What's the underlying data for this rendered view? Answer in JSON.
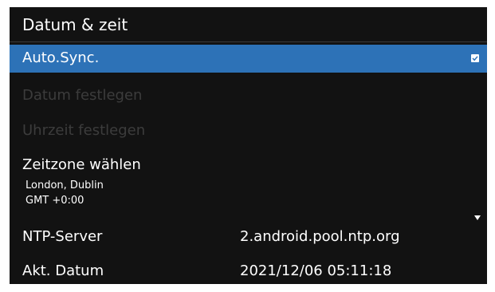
{
  "header": {
    "title": "Datum & zeit"
  },
  "menu": {
    "auto_sync": {
      "label": "Auto.Sync.",
      "checked": true
    },
    "set_date": {
      "label": "Datum festlegen"
    },
    "set_time": {
      "label": "Uhrzeit festlegen"
    },
    "time_zone": {
      "label": "Zeitzone wählen",
      "city": "London, Dublin",
      "offset": "GMT +0:00"
    },
    "ntp_server": {
      "label": "NTP-Server",
      "value": "2.android.pool.ntp.org"
    },
    "current_date": {
      "label": "Akt. Datum",
      "value": "2021/12/06 05:11:18"
    }
  },
  "colors": {
    "background": "#121212",
    "selection": "#2d72b7",
    "disabled_text": "#3c3c3c"
  },
  "icons": {
    "checkbox": "checkbox-checked-icon",
    "scroll": "scroll-down-arrow-icon"
  }
}
